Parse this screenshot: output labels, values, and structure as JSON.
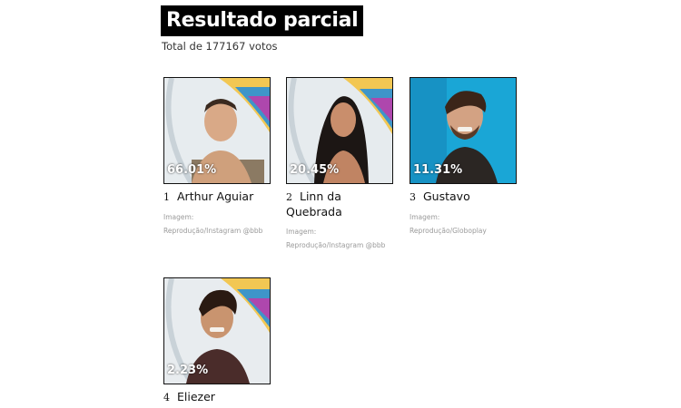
{
  "header": {
    "title": "Resultado parcial",
    "total": "Total de 177167 votos"
  },
  "candidates": [
    {
      "rank": "1",
      "name": "Arthur Aguiar",
      "percent": "66.01%",
      "credit": "Imagem: Reprodução/Instagram @bbb"
    },
    {
      "rank": "2",
      "name": "Linn da Quebrada",
      "percent": "20.45%",
      "credit": "Imagem: Reprodução/Instagram @bbb"
    },
    {
      "rank": "3",
      "name": "Gustavo",
      "percent": "11.31%",
      "credit": "Imagem: Reprodução/Globoplay"
    },
    {
      "rank": "4",
      "name": "Eliezer",
      "percent": "2.23%"
    }
  ]
}
